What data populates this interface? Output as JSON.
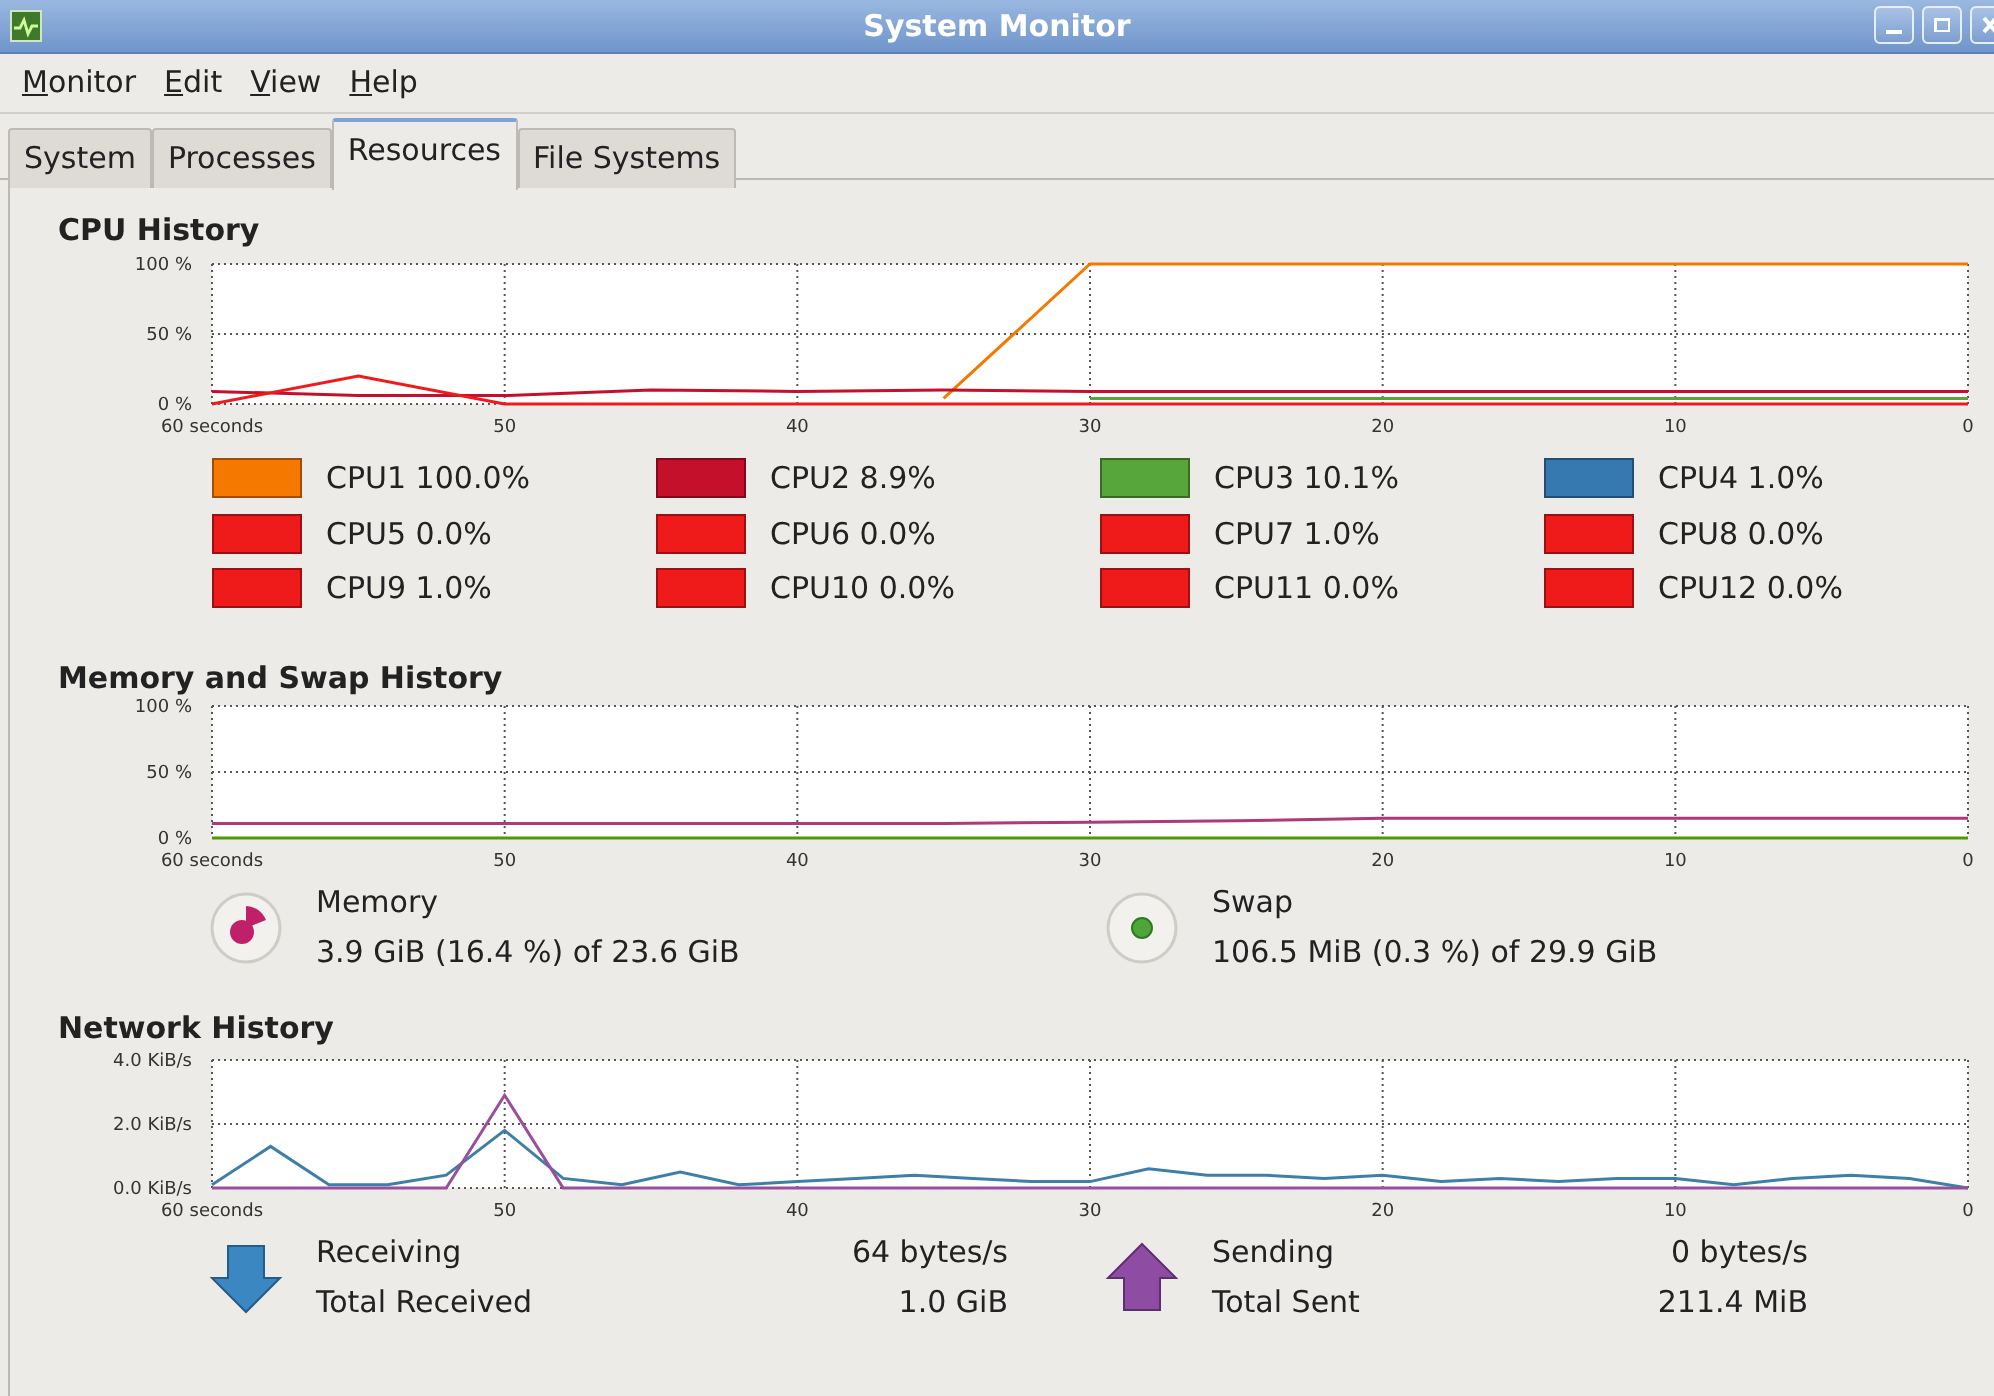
{
  "window": {
    "title": "System Monitor"
  },
  "menu": [
    "Monitor",
    "Edit",
    "View",
    "Help"
  ],
  "tabs": [
    {
      "label": "System",
      "selected": false
    },
    {
      "label": "Processes",
      "selected": false
    },
    {
      "label": "Resources",
      "selected": true
    },
    {
      "label": "File Systems",
      "selected": false
    }
  ],
  "cpu": {
    "title": "CPU History",
    "chart_data": {
      "type": "line",
      "grid": true,
      "x": [
        60,
        55,
        50,
        45,
        40,
        35,
        30,
        25,
        20,
        15,
        10,
        5,
        0
      ],
      "xlim": [
        60,
        0
      ],
      "xticks": [
        {
          "value": 60,
          "label": "60 seconds"
        },
        50,
        40,
        30,
        20,
        10,
        0
      ],
      "ylim": [
        0,
        100
      ],
      "yticks": [
        {
          "value": 0,
          "label": "0 %"
        },
        {
          "value": 50,
          "label": "50 %"
        },
        {
          "value": 100,
          "label": "100 %"
        }
      ],
      "series": [
        {
          "name": "CPU1",
          "color": "#f57900",
          "values": [
            null,
            null,
            null,
            null,
            null,
            4,
            100,
            100,
            100,
            100,
            100,
            100,
            100
          ]
        },
        {
          "name": "CPU2",
          "color": "#c4102a",
          "values": [
            9,
            6,
            6,
            10,
            9,
            10,
            9,
            9,
            9,
            9,
            9,
            9,
            9
          ]
        },
        {
          "name": "CPU3",
          "color": "#57a63b",
          "values": [
            null,
            null,
            null,
            null,
            null,
            null,
            4,
            4,
            4,
            4,
            4,
            4,
            4
          ]
        },
        {
          "name": "CPU4",
          "color": "#3579b0",
          "values": [
            null,
            null,
            null,
            null,
            null,
            null,
            null,
            null,
            null,
            null,
            null,
            null,
            null
          ]
        },
        {
          "name": "CPU5",
          "color": "#ef1a1a",
          "values": [
            0,
            20,
            0,
            0,
            0,
            0,
            0,
            0,
            0,
            0,
            0,
            0,
            0
          ]
        },
        {
          "name": "CPU6",
          "color": "#ef1a1a",
          "values": [
            null,
            null,
            null,
            null,
            null,
            null,
            null,
            null,
            null,
            null,
            null,
            null,
            null
          ]
        },
        {
          "name": "CPU7",
          "color": "#ef1a1a",
          "values": [
            null,
            null,
            null,
            null,
            null,
            null,
            null,
            null,
            null,
            null,
            null,
            null,
            null
          ]
        },
        {
          "name": "CPU8",
          "color": "#ef1a1a",
          "values": [
            null,
            null,
            null,
            null,
            null,
            null,
            null,
            null,
            null,
            null,
            null,
            null,
            null
          ]
        },
        {
          "name": "CPU9",
          "color": "#ef1a1a",
          "values": [
            null,
            null,
            null,
            null,
            null,
            null,
            null,
            null,
            null,
            null,
            null,
            null,
            null
          ]
        },
        {
          "name": "CPU10",
          "color": "#ef1a1a",
          "values": [
            null,
            null,
            null,
            null,
            null,
            null,
            null,
            null,
            null,
            null,
            null,
            null,
            null
          ]
        },
        {
          "name": "CPU11",
          "color": "#ef1a1a",
          "values": [
            null,
            null,
            null,
            null,
            null,
            null,
            null,
            null,
            null,
            null,
            null,
            null,
            null
          ]
        },
        {
          "name": "CPU12",
          "color": "#ef1a1a",
          "values": [
            null,
            null,
            null,
            null,
            null,
            null,
            null,
            null,
            null,
            null,
            null,
            null,
            null
          ]
        }
      ]
    },
    "readings": [
      "100.0%",
      "8.9%",
      "10.1%",
      "1.0%",
      "0.0%",
      "0.0%",
      "1.0%",
      "0.0%",
      "1.0%",
      "0.0%",
      "0.0%",
      "0.0%"
    ]
  },
  "memory": {
    "title": "Memory and Swap History",
    "chart_data": {
      "type": "line",
      "grid": true,
      "x": [
        60,
        55,
        50,
        45,
        40,
        35,
        30,
        25,
        20,
        15,
        10,
        5,
        0
      ],
      "xlim": [
        60,
        0
      ],
      "xticks": [
        {
          "value": 60,
          "label": "60 seconds"
        },
        50,
        40,
        30,
        20,
        10,
        0
      ],
      "ylim": [
        0,
        100
      ],
      "yticks": [
        {
          "value": 0,
          "label": "0 %"
        },
        {
          "value": 50,
          "label": "50 %"
        },
        {
          "value": 100,
          "label": "100 %"
        }
      ],
      "series": [
        {
          "name": "Memory",
          "color": "#ad3a7a",
          "values": [
            11,
            11,
            11,
            11,
            11,
            11,
            12,
            13,
            15,
            15,
            15,
            15,
            15
          ]
        },
        {
          "name": "Swap",
          "color": "#4e9a06",
          "values": [
            0,
            0,
            0,
            0,
            0,
            0,
            0,
            0,
            0,
            0,
            0,
            0,
            0
          ]
        }
      ]
    },
    "items": [
      {
        "kind": "memory",
        "detail": "3.9 GiB (16.4 %) of 23.6 GiB"
      },
      {
        "kind": "swap",
        "detail": "106.5 MiB (0.3 %) of 29.9 GiB"
      }
    ]
  },
  "network": {
    "title": "Network History",
    "chart_data": {
      "type": "line",
      "grid": true,
      "x": [
        60,
        58,
        56,
        54,
        52,
        50,
        48,
        46,
        44,
        42,
        40,
        38,
        36,
        34,
        32,
        30,
        28,
        26,
        24,
        22,
        20,
        18,
        16,
        14,
        12,
        10,
        8,
        6,
        4,
        2,
        0
      ],
      "xlim": [
        60,
        0
      ],
      "xticks": [
        {
          "value": 60,
          "label": "60 seconds"
        },
        50,
        40,
        30,
        20,
        10,
        0
      ],
      "ylim": [
        0,
        4
      ],
      "yticks": [
        {
          "value": 0,
          "label": "0.0 KiB/s"
        },
        {
          "value": 2,
          "label": "2.0 KiB/s"
        },
        {
          "value": 4,
          "label": "4.0 KiB/s"
        }
      ],
      "series": [
        {
          "name": "Receiving",
          "color": "#3e7fa8",
          "values": [
            0.1,
            1.3,
            0.1,
            0.1,
            0.4,
            1.8,
            0.3,
            0.1,
            0.5,
            0.1,
            0.2,
            0.3,
            0.4,
            0.3,
            0.2,
            0.2,
            0.6,
            0.4,
            0.4,
            0.3,
            0.4,
            0.2,
            0.3,
            0.2,
            0.3,
            0.3,
            0.1,
            0.3,
            0.4,
            0.3,
            0
          ]
        },
        {
          "name": "Sending",
          "color": "#9a4e9e",
          "values": [
            0,
            0,
            0,
            0,
            0,
            2.9,
            0,
            0,
            0,
            0,
            0,
            0,
            0,
            0,
            0,
            0,
            0,
            0,
            0,
            0,
            0,
            0,
            0,
            0,
            0,
            0,
            0,
            0,
            0,
            0,
            0
          ]
        }
      ]
    },
    "items": [
      {
        "kind": "receiving",
        "value": "64 bytes/s",
        "total_label": "Total Received",
        "total": "1.0 GiB"
      },
      {
        "kind": "sending",
        "value": "0 bytes/s",
        "total_label": "Total Sent",
        "total": "211.4 MiB"
      }
    ]
  }
}
